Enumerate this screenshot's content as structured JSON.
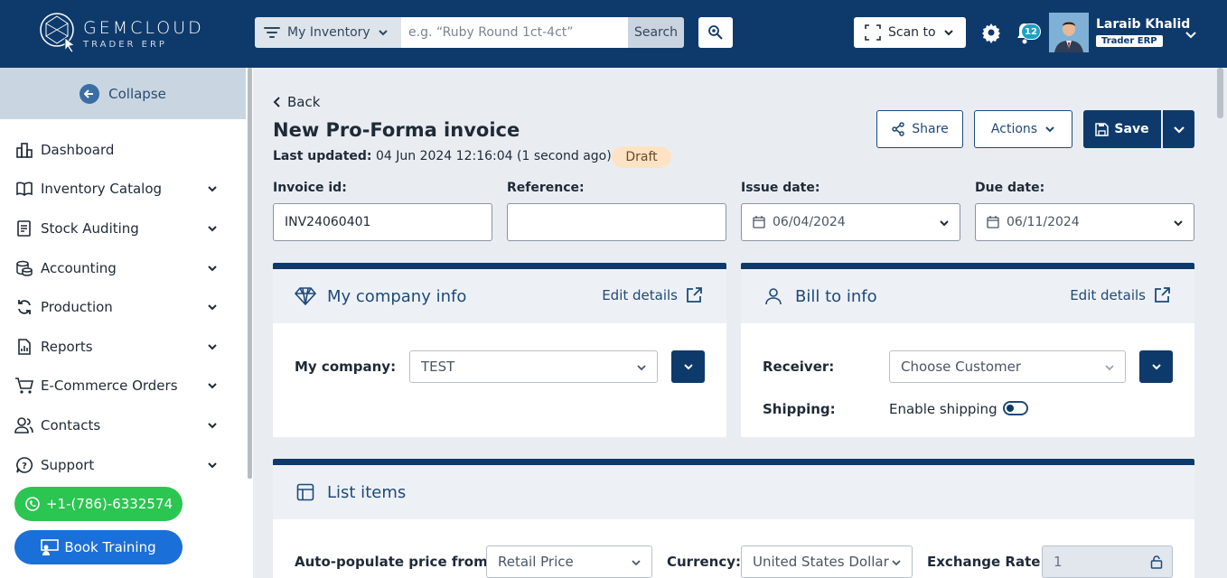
{
  "brand": {
    "title": "GEMCLOUD",
    "subtitle": "TRADER ERP"
  },
  "search": {
    "filter_label": "My Inventory",
    "placeholder": "e.g. “Ruby Round 1ct-4ct”",
    "button_label": "Search"
  },
  "topbar": {
    "scan_label": "Scan to",
    "notification_count": "12",
    "user_name": "Laraib Khalid",
    "user_role": "Trader ERP"
  },
  "sidebar": {
    "collapse_label": "Collapse",
    "items": [
      {
        "label": "Dashboard",
        "icon": "dashboard-icon",
        "has_chevron": false
      },
      {
        "label": "Inventory Catalog",
        "icon": "book-icon",
        "has_chevron": true
      },
      {
        "label": "Stock Auditing",
        "icon": "audit-icon",
        "has_chevron": true
      },
      {
        "label": "Accounting",
        "icon": "coins-icon",
        "has_chevron": true
      },
      {
        "label": "Production",
        "icon": "refresh-icon",
        "has_chevron": true
      },
      {
        "label": "Reports",
        "icon": "report-icon",
        "has_chevron": true
      },
      {
        "label": "E-Commerce Orders",
        "icon": "cart-icon",
        "has_chevron": true
      },
      {
        "label": "Contacts",
        "icon": "contacts-icon",
        "has_chevron": true
      },
      {
        "label": "Support",
        "icon": "support-icon",
        "has_chevron": true
      }
    ],
    "whatsapp_label": "+1-(786)-6332574",
    "training_label": "Book Training"
  },
  "page": {
    "back_label": "Back",
    "title": "New Pro-Forma invoice",
    "updated_label": "Last updated:",
    "updated_value": "04 Jun 2024 12:16:04 (1 second ago)",
    "status": "Draft",
    "share_label": "Share",
    "actions_label": "Actions",
    "save_label": "Save"
  },
  "fields": {
    "invoice_id_label": "Invoice id:",
    "invoice_id_value": "INV24060401",
    "reference_label": "Reference:",
    "reference_value": "",
    "issue_date_label": "Issue date:",
    "issue_date_value": "06/04/2024",
    "due_date_label": "Due date:",
    "due_date_value": "06/11/2024"
  },
  "company_card": {
    "title": "My company info",
    "edit_label": "Edit details",
    "company_label": "My company:",
    "company_value": "TEST"
  },
  "bill_card": {
    "title": "Bill to info",
    "edit_label": "Edit details",
    "receiver_label": "Receiver:",
    "receiver_placeholder": "Choose Customer",
    "shipping_label": "Shipping:",
    "shipping_toggle_label": "Enable shipping"
  },
  "items_card": {
    "title": "List items",
    "autopopulate_label": "Auto-populate price from:",
    "autopopulate_value": "Retail Price",
    "currency_label": "Currency:",
    "currency_value": "United States Dollar",
    "exchange_label": "Exchange Rate:",
    "exchange_value": "1"
  },
  "colors": {
    "primary": "#0e3a6b",
    "whatsapp": "#2bc551",
    "training": "#1b6fd8",
    "draft_bg": "#fde3c4"
  }
}
